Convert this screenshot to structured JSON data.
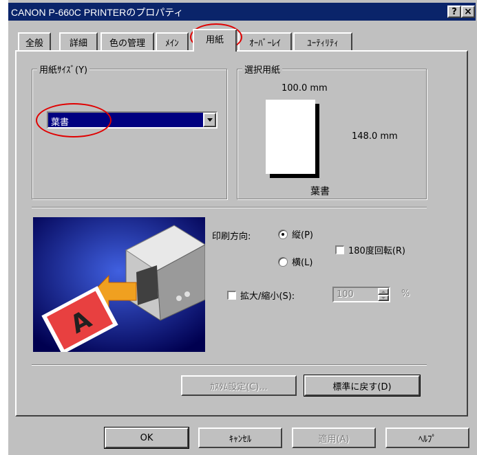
{
  "window": {
    "title": "CANON P-660C PRINTERのプロパティ",
    "help_btn": "?",
    "close_btn": "×"
  },
  "tabs": [
    {
      "label": "全般"
    },
    {
      "label": "詳細"
    },
    {
      "label": "色の管理"
    },
    {
      "label": "ﾒｲﾝ"
    },
    {
      "label": "用紙"
    },
    {
      "label": "ｵｰﾊﾞｰﾚｲ"
    },
    {
      "label": "ﾕｰﾃｨﾘﾃｨ"
    }
  ],
  "paper_size": {
    "label": "用紙ｻｲｽﾞ(Y)",
    "selected": "葉書"
  },
  "selected_paper": {
    "label": "選択用紙",
    "width": "100.0 mm",
    "height": "148.0 mm",
    "name": "葉書"
  },
  "orientation": {
    "label": "印刷方向:",
    "portrait": "縦(P)",
    "landscape": "横(L)",
    "portrait_selected": true
  },
  "rotate180": {
    "label": "180度回転(R)",
    "checked": false
  },
  "scale": {
    "label": "拡大/縮小(S):",
    "value": "100",
    "unit": "%",
    "checked": false
  },
  "buttons": {
    "custom": "ｶｽﾀﾑ設定(C)...",
    "reset": "標準に戻す(D)",
    "ok": "OK",
    "cancel": "ｷｬﾝｾﾙ",
    "apply": "適用(A)",
    "help": "ﾍﾙﾌﾟ"
  },
  "colors": {
    "title_bar": "#0a246a",
    "dialog": "#c0c0c0",
    "selection": "#000080",
    "annotation": "#e00000"
  }
}
